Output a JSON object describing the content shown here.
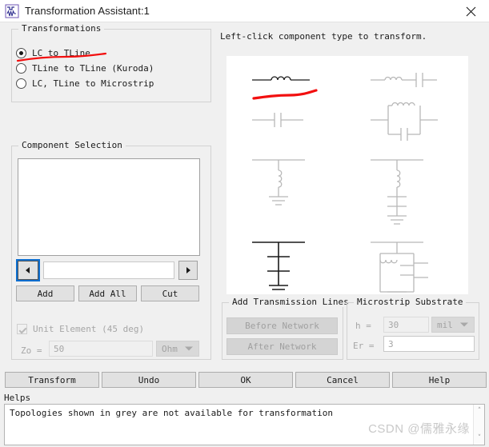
{
  "window": {
    "title": "Transformation Assistant:1",
    "icon": "circuit-waveform-icon",
    "close_label": "×"
  },
  "transformations": {
    "legend": "Transformations",
    "options": [
      {
        "label": "LC to TLine",
        "checked": true
      },
      {
        "label": "TLine to TLine (Kuroda)",
        "checked": false
      },
      {
        "label": "LC, TLine to Microstrip",
        "checked": false
      }
    ],
    "annotation": "red-underline-stroke"
  },
  "component_selection": {
    "legend": "Component Selection",
    "list_items": [],
    "nav": {
      "prev_icon": "triangle-left-icon",
      "next_icon": "triangle-right-icon"
    },
    "name_field": {
      "value": "",
      "placeholder": ""
    },
    "buttons": [
      {
        "label": "Add",
        "disabled": false
      },
      {
        "label": "Add All",
        "disabled": false
      },
      {
        "label": "Cut",
        "disabled": false
      }
    ],
    "unit_element": {
      "label": "Unit Element (45 deg)",
      "checked": true,
      "disabled": true
    },
    "zo": {
      "label": "Zo =",
      "value": "50",
      "unit": "Ohm",
      "disabled": true
    }
  },
  "canvas": {
    "instruction": "Left-click component type to transform.",
    "active_color": "#1a1a1a",
    "disabled_color": "#b8b8b8",
    "annotation_color": "#f20f0f",
    "topologies": [
      {
        "name": "series-inductor",
        "enabled": true
      },
      {
        "name": "series-inductor-capacitor",
        "enabled": false
      },
      {
        "name": "series-capacitor",
        "enabled": false
      },
      {
        "name": "parallel-lc-tank",
        "enabled": false
      },
      {
        "name": "shunt-inductor",
        "enabled": false
      },
      {
        "name": "shunt-inductor-capacitor",
        "enabled": false
      },
      {
        "name": "shunt-capacitor",
        "enabled": true
      },
      {
        "name": "shunt-parallel-lc",
        "enabled": false
      }
    ]
  },
  "add_transmission_lines": {
    "legend": "Add Transmission Lines",
    "buttons": [
      {
        "label": "Before Network",
        "disabled": true
      },
      {
        "label": "After Network",
        "disabled": true
      }
    ]
  },
  "microstrip_substrate": {
    "legend": "Microstrip Substrate",
    "h": {
      "label": "h =",
      "value": "30",
      "unit": "mil",
      "disabled": true
    },
    "er": {
      "label": "Er =",
      "value": "3",
      "disabled": true
    }
  },
  "footer": {
    "buttons": [
      {
        "label": "Transform"
      },
      {
        "label": "Undo"
      },
      {
        "label": "OK"
      },
      {
        "label": "Cancel"
      },
      {
        "label": "Help"
      }
    ]
  },
  "helps": {
    "label": "Helps",
    "text": "Topologies shown in grey are not available for transformation",
    "scroll_up": "˄",
    "scroll_down": "˅",
    "watermark": "CSDN @儒雅永缘"
  }
}
